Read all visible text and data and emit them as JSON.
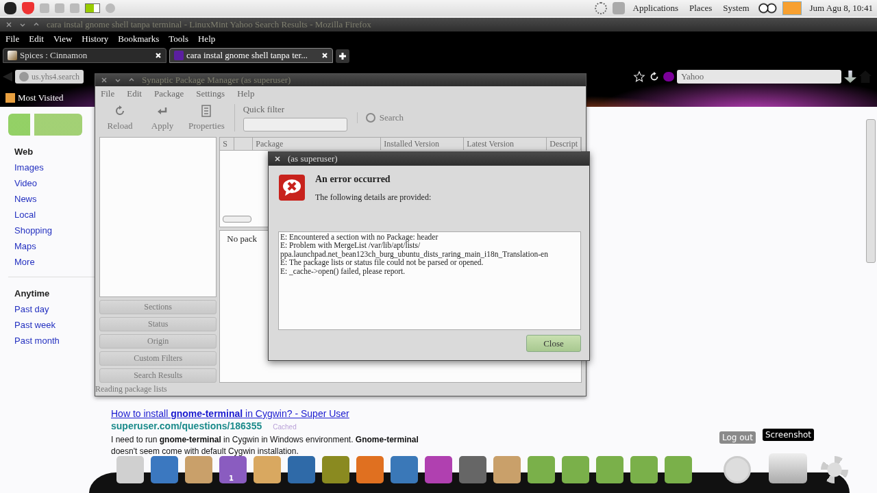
{
  "top_panel": {
    "menus": [
      "Applications",
      "Places",
      "System"
    ],
    "clock": "Jum Agu  8, 10:41"
  },
  "firefox": {
    "title": "cara instal gnome shell tanpa terminal - LinuxMint Yahoo Search Results - Mozilla Firefox",
    "menu": [
      "File",
      "Edit",
      "View",
      "History",
      "Bookmarks",
      "Tools",
      "Help"
    ],
    "tabs": [
      {
        "label": "Spices : Cinnamon",
        "selected": false
      },
      {
        "label": "cara instal gnome shell tanpa ter...",
        "selected": true
      }
    ],
    "url": "us.yhs4.search",
    "search": {
      "placeholder": "Yahoo"
    },
    "bookmarks": [
      "Most Visited"
    ]
  },
  "page": {
    "sidebar_groups": [
      {
        "items": [
          {
            "label": "Web",
            "selected": true
          },
          {
            "label": "Images",
            "selected": false
          },
          {
            "label": "Video",
            "selected": false
          },
          {
            "label": "News",
            "selected": false
          },
          {
            "label": "Local",
            "selected": false
          },
          {
            "label": "Shopping",
            "selected": false
          },
          {
            "label": "Maps",
            "selected": false
          },
          {
            "label": "More",
            "selected": false
          }
        ]
      },
      {
        "items": [
          {
            "label": "Anytime",
            "selected": true
          },
          {
            "label": "Past day",
            "selected": false
          },
          {
            "label": "Past week",
            "selected": false
          },
          {
            "label": "Past month",
            "selected": false
          }
        ]
      }
    ],
    "result": {
      "title": "How to install **gnome-terminal** in Cygwin? - Super User",
      "url": "superuser.com/questions/186355",
      "cached": "Cached",
      "snippet": "I need to run **gnome-terminal** in Cygwin in Windows environment. **Gnome-terminal** doesn't seem come with default Cygwin installation."
    }
  },
  "synaptic": {
    "title": "Synaptic Package Manager  (as superuser)",
    "menu": [
      "File",
      "Edit",
      "Package",
      "Settings",
      "Help"
    ],
    "toolbar": [
      {
        "label": "Reload",
        "kind": "reload"
      },
      {
        "label": "Apply",
        "kind": "apply"
      },
      {
        "label": "Properties",
        "kind": "properties"
      }
    ],
    "quick_filter": "Quick filter",
    "search": "Search",
    "columns": [
      "S",
      "",
      "Package",
      "Installed Version",
      "Latest Version",
      "Descript"
    ],
    "info": "No pack",
    "filters": [
      "Sections",
      "Status",
      "Origin",
      "Custom Filters",
      "Search Results"
    ],
    "status": "Reading package lists"
  },
  "dialog": {
    "title": "(as superuser)",
    "heading": "An error occurred",
    "subtitle": "The following details are provided:",
    "details": [
      "E: Encountered a section with no Package: header",
      "E: Problem with MergeList /var/lib/apt/lists/",
      "ppa.launchpad.net_bean123ch_burg_ubuntu_dists_raring_main_i18n_Translation-en",
      "E: The package lists or status file could not be parsed or opened.",
      "E: _cache->open() failed, please report."
    ],
    "button": "Close"
  },
  "dock": {
    "badge": "1",
    "tooltips": [
      "Log out",
      "Screenshot"
    ]
  }
}
